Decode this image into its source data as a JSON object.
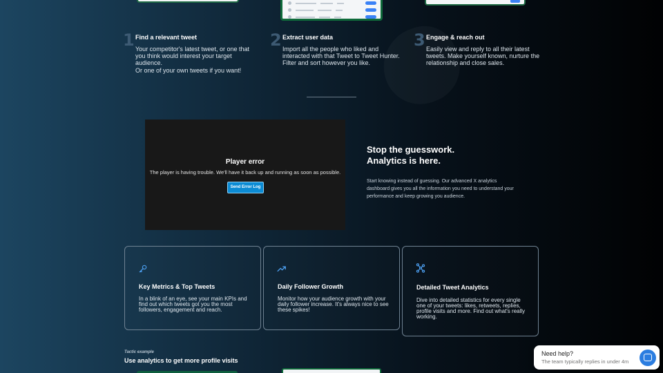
{
  "steps": [
    {
      "number": "1",
      "title": "Find a relevant tweet",
      "description": "Your competitor's latest tweet, or one that you think would interest your target audience.",
      "extra": "Or one of your own tweets if you want!"
    },
    {
      "number": "2",
      "title": "Extract user data",
      "description": "Import all the people who liked and interacted with that Tweet to Tweet Hunter. Filter and sort however you like."
    },
    {
      "number": "3",
      "title": "Engage & reach out",
      "description": "Easily view and reply to all their latest tweets. Make yourself known, nurture the relationship and close sales."
    }
  ],
  "player": {
    "title": "Player error",
    "message": "The player is having trouble. We'll have it back up and running as soon as possible.",
    "button": "Send Error Log"
  },
  "hero": {
    "line1": "Stop the guesswork.",
    "line2": "Analytics is here.",
    "paragraph": "Start knowing instead of guessing. Our advanced X analytics dashboard gives you all the information you need to understand your performance and keep growing you audience."
  },
  "cards": [
    {
      "icon": "key-icon",
      "title": "Key Metrics & Top Tweets",
      "description": "In a blink of an eye, see your main KPIs and find out which tweets got you the most followers, engagement and reach."
    },
    {
      "icon": "trending-up-icon",
      "title": "Daily Follower Growth",
      "description": "Monitor how your audience growth with your daily follower increase. It's always nice to see these spikes!"
    },
    {
      "icon": "network-icon",
      "title": "Detailed Tweet Analytics",
      "description": "Dive into detailed statistics for every single one of your tweets: likes, retweets, replies, profile visits and more. Find out what's really working."
    }
  ],
  "tactic": {
    "label": "Tactic example",
    "title": "Use analytics to get more profile visits"
  },
  "help_widget": {
    "title": "Need help?",
    "subtitle": "The team typically replies in under 4m"
  },
  "colors": {
    "accent_blue": "#3b82f6",
    "icon_blue": "#4ea1f3",
    "player_button": "#0b8bd4"
  }
}
